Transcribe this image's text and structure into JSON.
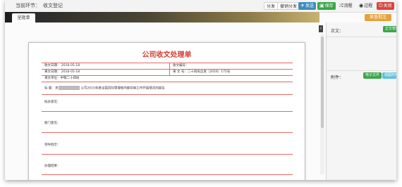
{
  "header": {
    "crumb_label": "当前环节：",
    "crumb_value": "收文登记"
  },
  "toolbar": {
    "branch_label": "分发",
    "cancel_branch_label": "撤销分发",
    "send_label": "发送",
    "save_label": "保存",
    "flow_label": "流程",
    "process_label": "过程",
    "close_label": "关闭"
  },
  "tabs": [
    "呈批单"
  ],
  "approve_button": "显查批注",
  "collapse_glyph": "›",
  "document": {
    "title": "公司收文处理单",
    "rows": {
      "receive_date": "收文日期： 2016-05-18",
      "receive_no": "收文编号：",
      "incoming_date": "来文日期： 2016-05-18",
      "incoming_no": "来 文 号：二十四局企发（2016）175号",
      "incoming_unit": "来文单位：中铁二十四局",
      "subject_label": "标      题：",
      "subject_prefix": "关",
      "subject_suffix": "公司2015年度全面风险管理和内部控制工作开展情况的报告",
      "dispatch_opinion": "拟办意见：",
      "dept_opinion": "部门意见：",
      "leader_instruction": "领导批示：",
      "result": "办理结果："
    }
  },
  "right": {
    "body_label": "正文：",
    "body_button": "正文管理",
    "attach_label": "附件：",
    "attach_button": "电子文件",
    "attach_view_button": "视图附件"
  },
  "colors": {
    "accent_blue": "#3c8dbc",
    "accent_green": "#3aa64a",
    "accent_red": "#d9453e",
    "accent_orange": "#e8a13b",
    "doc_red": "#d43a2f"
  }
}
